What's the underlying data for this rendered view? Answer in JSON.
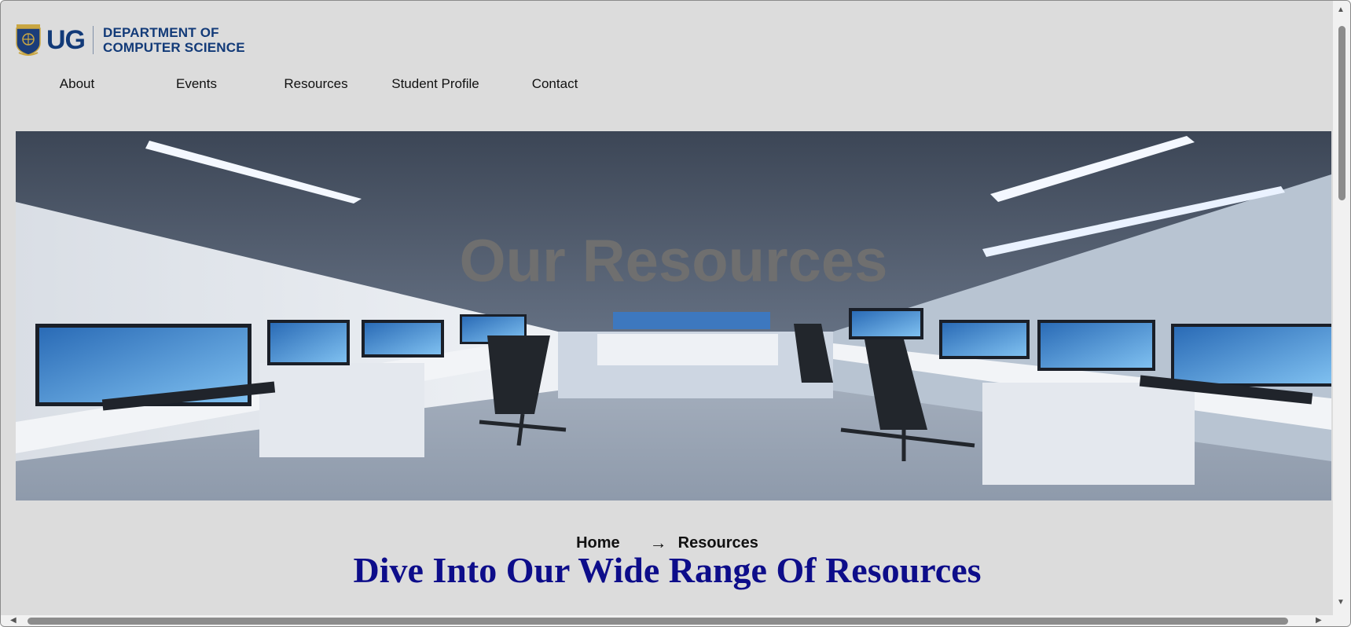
{
  "header": {
    "logo_mark": "UG",
    "logo_line1": "DEPARTMENT OF",
    "logo_line2": "COMPUTER SCIENCE"
  },
  "nav": {
    "items": [
      {
        "label": "About"
      },
      {
        "label": "Events"
      },
      {
        "label": "Resources"
      },
      {
        "label": "Student Profile"
      },
      {
        "label": "Contact"
      }
    ]
  },
  "hero": {
    "title": "Our Resources"
  },
  "breadcrumb": {
    "home": "Home",
    "separator": "→",
    "current": "Resources"
  },
  "section": {
    "title": "Dive Into Our Wide Range Of Resources"
  },
  "colors": {
    "brand_navy": "#123a78",
    "section_title": "#0d0d8a",
    "page_bg": "#dcdcdc"
  }
}
